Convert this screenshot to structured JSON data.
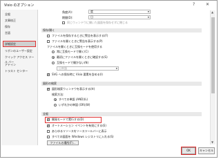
{
  "window": {
    "title": "Visio のオプション",
    "minimize": "—",
    "help": "?",
    "close": "✕"
  },
  "sidebar": {
    "items": [
      {
        "label": "全般"
      },
      {
        "label": "文章校正"
      },
      {
        "label": "保存"
      },
      {
        "label": "言語"
      },
      {
        "label": "詳細設定",
        "selected": true
      },
      {
        "label": "リボンのユーザー設定"
      },
      {
        "label": "クイック アクセス ツール バー"
      },
      {
        "label": "アドイン"
      },
      {
        "label": "トラスト センター"
      }
    ]
  },
  "top": {
    "row1_label": "角度(A):",
    "row1_value": "度",
    "row2_label": "期間(D):",
    "row2_value": "日",
    "row3_text": "同じウィンドウに開いた図面を保存せずに閉じる"
  },
  "save_open": {
    "header": "保存/開く",
    "items": [
      {
        "label": "ファイルを保存するときに警告を表示する(F)",
        "checked": false
      },
      {
        "label": "ファイルを開くときに警告を表示する(P)",
        "checked": false
      }
    ],
    "subhead": "ファイルを開くときに互換モードを使用する",
    "radios": [
      {
        "label": "常に互換モードで開く(C)",
        "on": false
      },
      {
        "label": "最初にファイルを開くときに確認する(S)",
        "on": true
      },
      {
        "label": "互換モードで開かない(N)",
        "on": false
      }
    ],
    "select_value": "日本語",
    "svg_item": {
      "label": "SVG への保存時に Visio  要素を含める(I)",
      "checked": true
    }
  },
  "figure_search": {
    "header": "図形の検索",
    "show_item": {
      "label": "図形検索ウィンドウを表示する(H)",
      "checked": true
    },
    "search_method": "検索方法:",
    "radios": [
      {
        "label": "すべての単語 (AND)(L)",
        "on": true
      },
      {
        "label": "いずれかの単語 (OR)(W)",
        "on": false
      }
    ]
  },
  "general": {
    "header": "全般",
    "items": [
      {
        "label": "開発モードで実行する(D)",
        "checked": true
      },
      {
        "label": "オートメーション イベントを有効にする(E)",
        "checked": true
      },
      {
        "label": "あらゆるリソースをソースツールバーに表示",
        "checked": false
      },
      {
        "label": "すべての図面を Windows レジストリに入れる(S)",
        "checked": false
      }
    ],
    "file_location_button": "ファイルの場所(F)..."
  },
  "footer": {
    "ok": "OK",
    "cancel": "キャンセル"
  }
}
